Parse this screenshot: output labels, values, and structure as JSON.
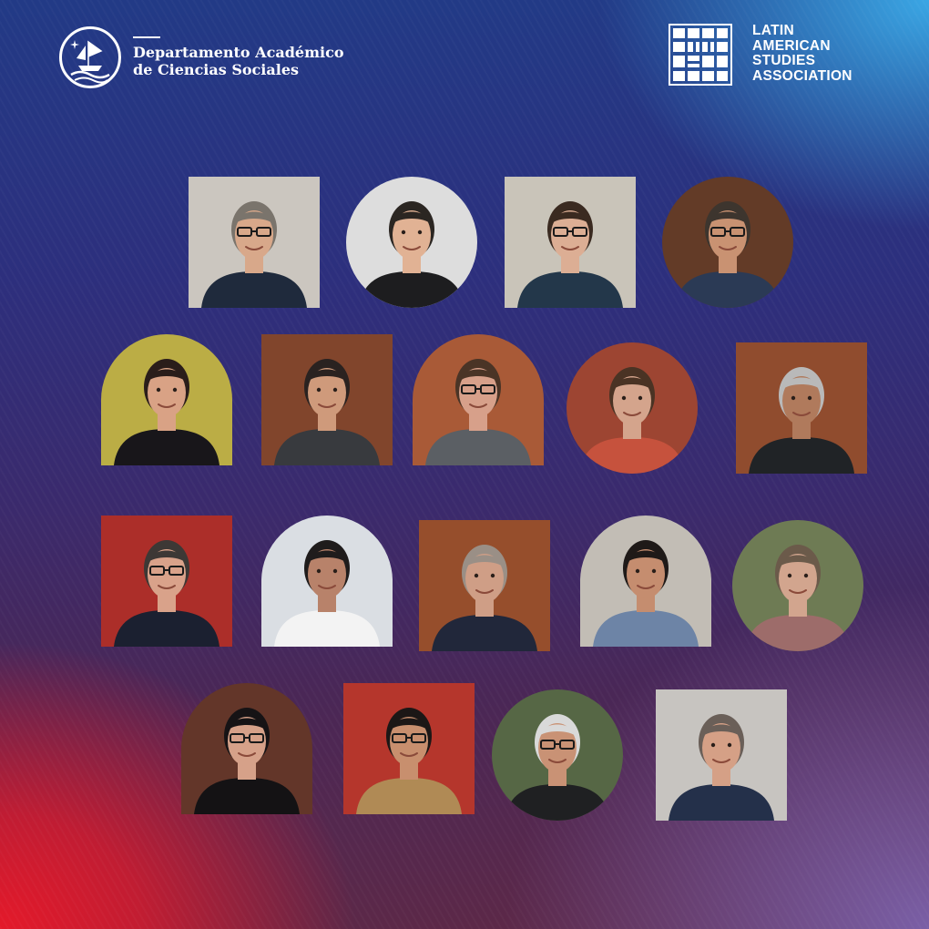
{
  "header": {
    "department_line1": "Departamento Académico",
    "department_line2": "de Ciencias Sociales",
    "emblem_icon": "ship-emblem-icon",
    "lasa_logo_icon": "lasa-grid-logo-icon",
    "lasa_lines": [
      "LATIN",
      "AMERICAN",
      "STUDIES",
      "ASSOCIATION"
    ]
  },
  "colors": {
    "red": "#e4192a",
    "navy": "#223a86",
    "sky": "#3aa6e4",
    "violet": "#7a5fa6",
    "text": "#ffffff"
  },
  "portraits": [
    {
      "row": 1,
      "shape": "square",
      "bg": "#d9d4cc",
      "skin": "#d8a88a",
      "hair": "#7a746c",
      "shirt": "#1f2a3c",
      "glasses": true
    },
    {
      "row": 1,
      "shape": "circle",
      "bg": "#ececec",
      "skin": "#e1b294",
      "hair": "#2b2622",
      "shirt": "#1d1d1f",
      "glasses": false
    },
    {
      "row": 1,
      "shape": "square",
      "bg": "#d7d2c6",
      "skin": "#dcae94",
      "hair": "#3a2a20",
      "shirt": "#23374a",
      "glasses": true
    },
    {
      "row": 1,
      "shape": "circle",
      "bg": "#6a3f2a",
      "skin": "#c99272",
      "hair": "#3d352e",
      "shirt": "#2b3a55",
      "glasses": true
    },
    {
      "row": 2,
      "shape": "arch",
      "bg": "#c8b94a",
      "skin": "#d9a285",
      "hair": "#2a1d1a",
      "shirt": "#18161a",
      "glasses": false
    },
    {
      "row": 2,
      "shape": "square",
      "bg": "#8a4a2f",
      "skin": "#cf9a7b",
      "hair": "#2a2220",
      "shirt": "#383a3e",
      "glasses": false
    },
    {
      "row": 2,
      "shape": "arch",
      "bg": "#b5613b",
      "skin": "#d7a08a",
      "hair": "#4a3426",
      "shirt": "#5b5f64",
      "glasses": true
    },
    {
      "row": 2,
      "shape": "circle",
      "bg": "#a84a36",
      "skin": "#d4a48c",
      "hair": "#4a3324",
      "shirt": "#c6523d",
      "glasses": false
    },
    {
      "row": 2,
      "shape": "square",
      "bg": "#9a5232",
      "skin": "#b07a5c",
      "hair": "#b9b9b9",
      "shirt": "#202326",
      "glasses": false
    },
    {
      "row": 3,
      "shape": "square",
      "bg": "#b8322c",
      "skin": "#d9a28a",
      "hair": "#3d3835",
      "shirt": "#1b2030",
      "glasses": true
    },
    {
      "row": 3,
      "shape": "arch",
      "bg": "#e9edf3",
      "skin": "#b8826a",
      "hair": "#1f1c1c",
      "shirt": "#f3f3f3",
      "glasses": false
    },
    {
      "row": 3,
      "shape": "square",
      "bg": "#a1542f",
      "skin": "#cf9e86",
      "hair": "#9a8f86",
      "shirt": "#21273a",
      "glasses": false
    },
    {
      "row": 3,
      "shape": "arch",
      "bg": "#cfcac2",
      "skin": "#c58d6f",
      "hair": "#1f1a18",
      "shirt": "#6d84a6",
      "glasses": false
    },
    {
      "row": 3,
      "shape": "circle",
      "bg": "#76845a",
      "skin": "#d2a58e",
      "hair": "#6b5a4a",
      "shirt": "#9d6c6a",
      "glasses": false
    },
    {
      "row": 4,
      "shape": "arch",
      "bg": "#6a3a2c",
      "skin": "#d6a189",
      "hair": "#161315",
      "shirt": "#141214",
      "glasses": true
    },
    {
      "row": 4,
      "shape": "square",
      "bg": "#c23a2f",
      "skin": "#c88f6e",
      "hair": "#1c1716",
      "shirt": "#b08a55",
      "glasses": true
    },
    {
      "row": 4,
      "shape": "circle",
      "bg": "#5c6e4a",
      "skin": "#c99275",
      "hair": "#d9d9d9",
      "shirt": "#1f2022",
      "glasses": true
    },
    {
      "row": 4,
      "shape": "square",
      "bg": "#d5d2cd",
      "skin": "#d5a086",
      "hair": "#6a5f58",
      "shirt": "#24304a",
      "glasses": false
    }
  ]
}
